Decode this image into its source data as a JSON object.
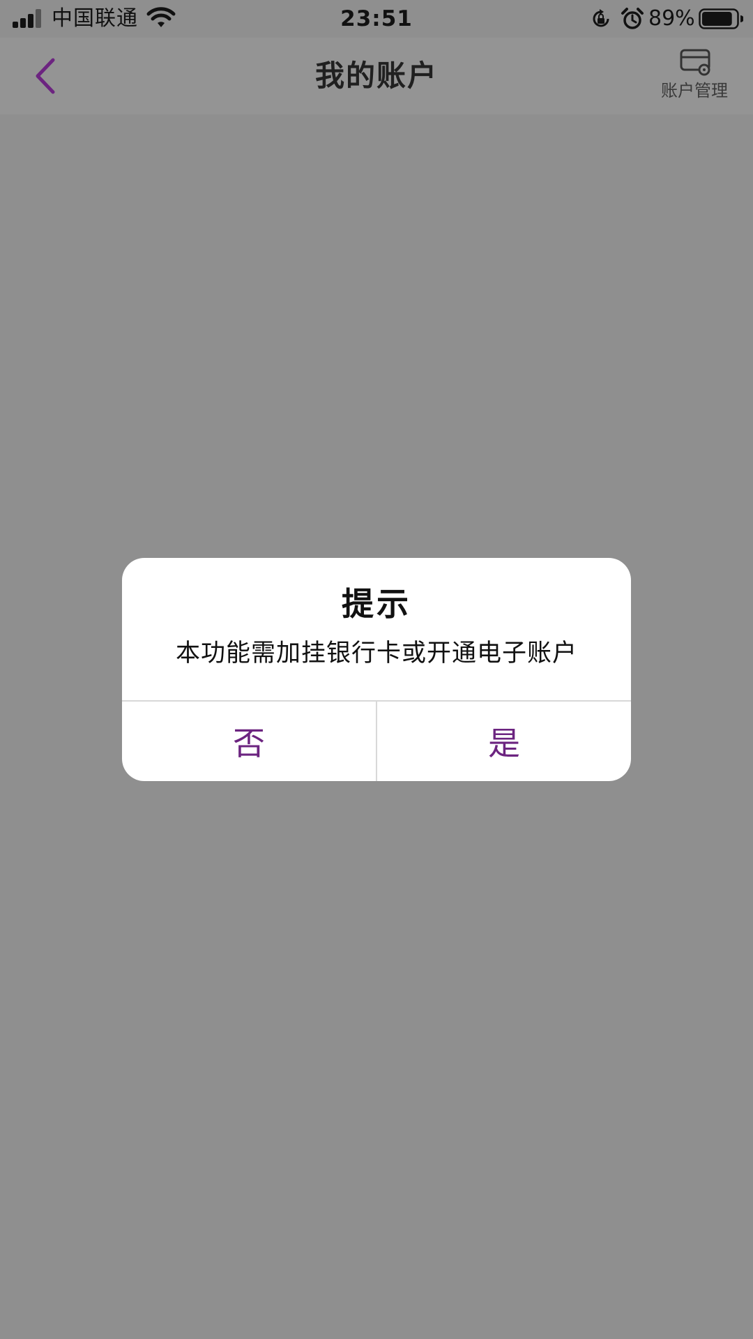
{
  "status_bar": {
    "carrier": "中国联通",
    "time": "23:51",
    "battery_percent": "89%",
    "battery_level": 0.89,
    "signal_bars_active": 3,
    "icons": [
      "signal-icon",
      "wifi-icon",
      "rotation-lock-icon",
      "alarm-icon",
      "battery-icon"
    ]
  },
  "nav": {
    "title": "我的账户",
    "back_icon": "chevron-left-icon",
    "manage_label": "账户管理",
    "manage_icon": "card-settings-icon"
  },
  "dialog": {
    "title": "提示",
    "message": "本功能需加挂银行卡或开通电子账户",
    "cancel_label": "否",
    "confirm_label": "是"
  },
  "colors": {
    "overlay": "#8f8f8f",
    "accent": "#6c2480",
    "dialog_bg": "#ffffff"
  }
}
